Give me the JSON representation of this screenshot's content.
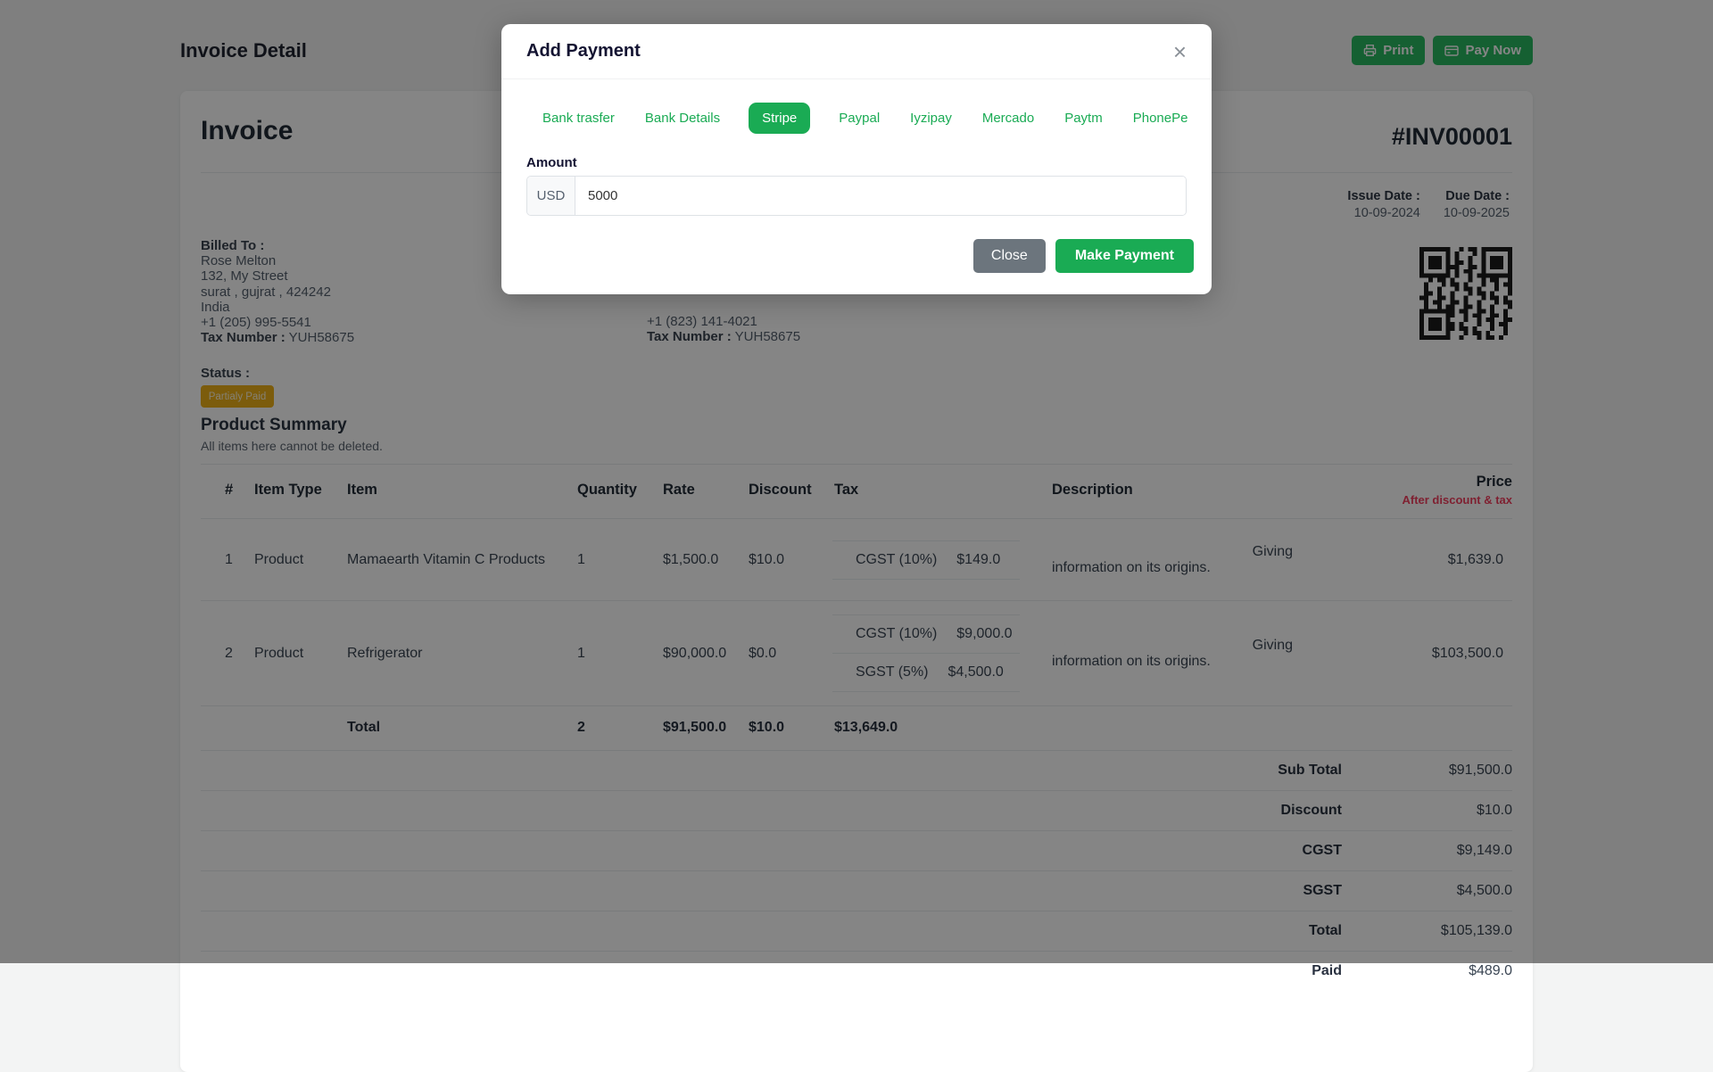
{
  "page": {
    "title": "Invoice Detail",
    "print_label": "Print",
    "pay_now_label": "Pay Now"
  },
  "invoice": {
    "heading": "Invoice",
    "number": "#INV00001",
    "issue_date_label": "Issue Date :",
    "issue_date": "10-09-2024",
    "due_date_label": "Due Date :",
    "due_date": "10-09-2025",
    "billed_to": {
      "label": "Billed To :",
      "name": "Rose Melton",
      "address1": "132, My Street",
      "address2": "surat , gujrat , 424242",
      "country": "India",
      "phone": "+1 (205) 995-5541",
      "tax_label": "Tax Number :",
      "tax_number": "YUH58675"
    },
    "shipped_to_visible": {
      "phone": "+1 (823) 141-4021",
      "tax_label": "Tax Number :",
      "tax_number": "YUH58675"
    },
    "status_label": "Status :",
    "status_badge": "Partialy Paid"
  },
  "product_summary": {
    "title": "Product Summary",
    "subtitle": "All items here cannot be deleted.",
    "columns": {
      "num": "#",
      "item_type": "Item Type",
      "item": "Item",
      "quantity": "Quantity",
      "rate": "Rate",
      "discount": "Discount",
      "tax": "Tax",
      "description": "Description",
      "price": "Price"
    },
    "price_subnote": "After discount & tax",
    "rows": [
      {
        "num": "1",
        "type": "Product",
        "item": "Mamaearth Vitamin C Products",
        "qty": "1",
        "rate": "$1,500.0",
        "discount": "$10.0",
        "taxes": [
          {
            "name": "CGST (10%)",
            "amount": "$149.0"
          }
        ],
        "desc_line1": "Giving",
        "desc_line2": "information on its origins.",
        "price": "$1,639.0"
      },
      {
        "num": "2",
        "type": "Product",
        "item": "Refrigerator",
        "qty": "1",
        "rate": "$90,000.0",
        "discount": "$0.0",
        "taxes": [
          {
            "name": "CGST (10%)",
            "amount": "$9,000.0"
          },
          {
            "name": "SGST (5%)",
            "amount": "$4,500.0"
          }
        ],
        "desc_line1": "Giving",
        "desc_line2": "information on its origins.",
        "price": "$103,500.0"
      }
    ],
    "total_row": {
      "label": "Total",
      "qty": "2",
      "rate": "$91,500.0",
      "discount": "$10.0",
      "tax": "$13,649.0"
    },
    "summary": [
      {
        "label": "Sub Total",
        "value": "$91,500.0"
      },
      {
        "label": "Discount",
        "value": "$10.0"
      },
      {
        "label": "CGST",
        "value": "$9,149.0"
      },
      {
        "label": "SGST",
        "value": "$4,500.0"
      },
      {
        "label": "Total",
        "value": "$105,139.0"
      },
      {
        "label": "Paid",
        "value": "$489.0"
      }
    ]
  },
  "modal": {
    "title": "Add Payment",
    "close_icon": "×",
    "tabs": [
      "Bank trasfer",
      "Bank Details",
      "Stripe",
      "Paypal",
      "Iyzipay",
      "Mercado",
      "Paytm",
      "PhonePe"
    ],
    "active_tab": "Stripe",
    "amount_label": "Amount",
    "currency": "USD",
    "amount_value": "5000",
    "close_label": "Close",
    "submit_label": "Make Payment"
  },
  "colors": {
    "accent_green": "#1aab54",
    "status_badge_amber": "#eeb117",
    "price_note_red": "#f43f5e",
    "close_button_gray": "#6c757d"
  }
}
